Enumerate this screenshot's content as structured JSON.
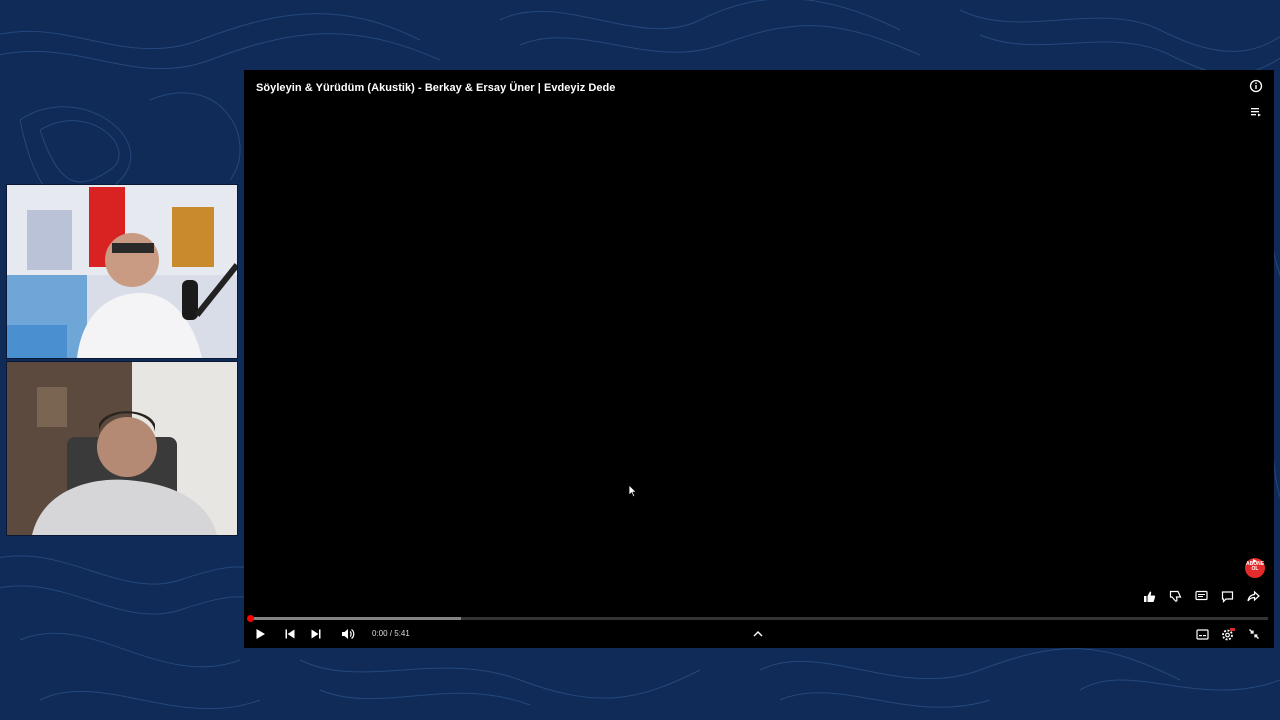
{
  "video": {
    "title": "Söyleyin & Yürüdüm (Akustik) - Berkay & Ersay Üner | Evdeyiz Dede",
    "time_display": "0:00 / 5:41",
    "played_fraction": 0.0,
    "buffered_fraction": 0.207
  },
  "overlay": {
    "subscribe_badge": "ABONE OL"
  },
  "colors": {
    "background": "#0f2a55",
    "progress_red": "#ff0000",
    "player_bg": "#000000"
  },
  "icons": {
    "top_right": [
      "info-icon",
      "queue-icon"
    ],
    "actions": [
      "like-icon",
      "dislike-icon",
      "comment-icon",
      "chat-icon",
      "share-icon"
    ],
    "left_controls": [
      "play-icon",
      "previous-icon",
      "next-icon",
      "volume-icon"
    ],
    "center_controls": [
      "chevron-up-icon"
    ],
    "right_controls": [
      "subtitles-icon",
      "settings-icon",
      "exit-fullscreen-icon"
    ]
  }
}
